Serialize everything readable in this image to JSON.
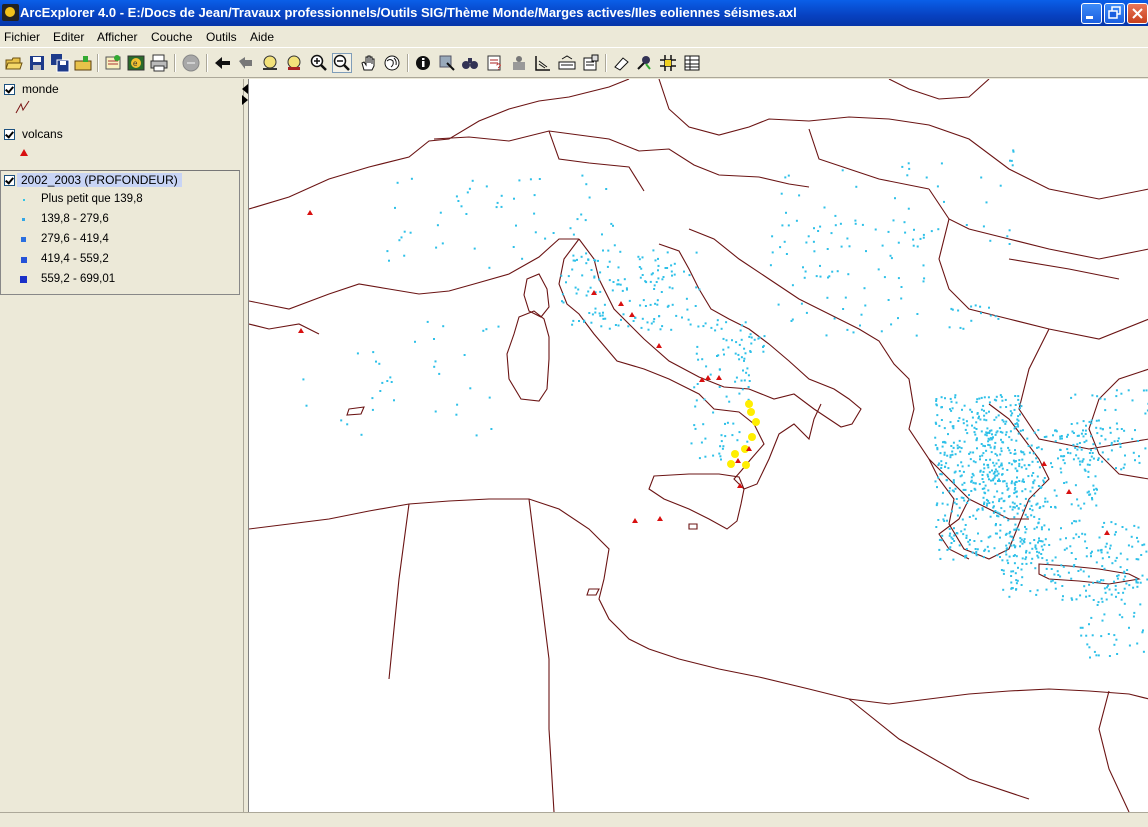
{
  "window": {
    "title": "ArcExplorer 4.0 - E:/Docs de Jean/Travaux professionnels/Outils SIG/Thème Monde/Marges actives/Iles eoliennes séismes.axl"
  },
  "menu": [
    "Fichier",
    "Editer",
    "Afficher",
    "Couche",
    "Outils",
    "Aide"
  ],
  "toolbar_icons": [
    "open-icon",
    "save-icon",
    "save-all-icon",
    "open-folder-icon",
    "add-layer-icon",
    "add-image-icon",
    "print-icon",
    "stop-icon",
    "back-extent-icon",
    "forward-extent-icon",
    "full-extent-icon",
    "zoom-layer-icon",
    "zoom-in-icon",
    "zoom-out-icon",
    "pan-icon",
    "globe-icon",
    "identify-icon",
    "select-icon",
    "query-icon",
    "find-icon",
    "hyperlink-icon",
    "measure-icon",
    "graticule-icon",
    "properties-icon",
    "erase-icon",
    "tool-icon",
    "grid-icon",
    "table-icon"
  ],
  "layers": [
    {
      "name": "monde",
      "checked": true,
      "symbol": "line",
      "color": "#7a1414"
    },
    {
      "name": "volcans",
      "checked": true,
      "symbol": "triangle",
      "color": "#d81010"
    },
    {
      "name": "2002_2003 (PROFONDEUR)",
      "checked": true,
      "selected": true,
      "classes": [
        {
          "label": "Plus petit que 139,8",
          "color": "#33c4e6"
        },
        {
          "label": "139,8 - 279,6",
          "color": "#33a6e6"
        },
        {
          "label": "279,6 - 419,4",
          "color": "#2a6fe0"
        },
        {
          "label": "419,4 - 559,2",
          "color": "#2452d8"
        },
        {
          "label": "559,2 - 699,01",
          "color": "#1a30c8"
        }
      ]
    }
  ],
  "map": {
    "coast_color": "#6b1414",
    "quake_color": "#2ec0e8",
    "volcano_color": "#d81010",
    "highlight_color": "#ffee00"
  }
}
